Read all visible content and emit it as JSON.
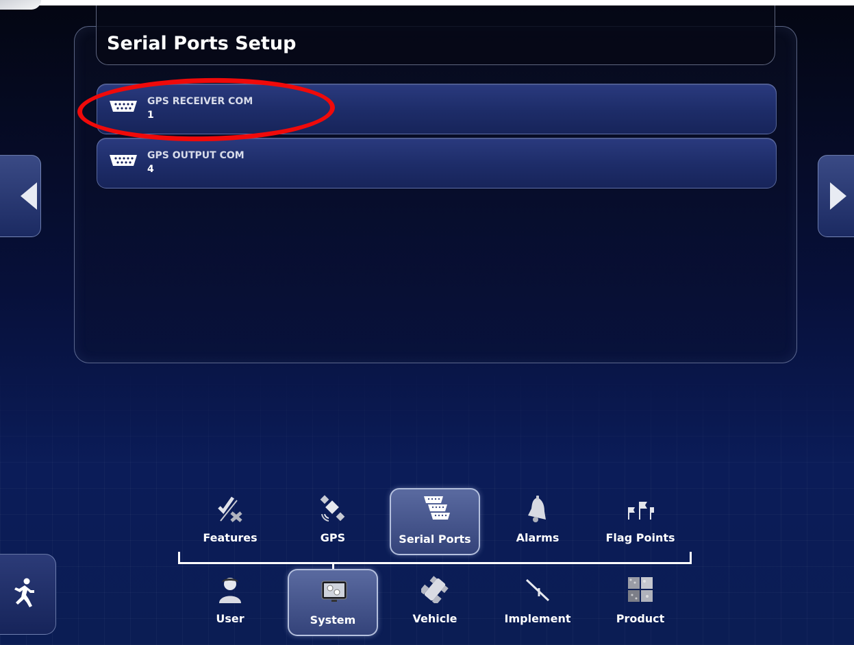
{
  "page": {
    "title": "Serial Ports Setup"
  },
  "ports": [
    {
      "label": "GPS RECEIVER COM",
      "value": "1",
      "icon": "serial-port-icon"
    },
    {
      "label": "GPS OUTPUT COM",
      "value": "4",
      "icon": "serial-port-icon"
    }
  ],
  "nav": {
    "left_icon": "left-arrow-icon",
    "right_icon": "right-arrow-icon",
    "exit_icon": "running-man-icon"
  },
  "sub_tabs": [
    {
      "label": "Features",
      "icon": "check-x-icon",
      "selected": false
    },
    {
      "label": "GPS",
      "icon": "satellite-icon",
      "selected": false
    },
    {
      "label": "Serial Ports",
      "icon": "serial-ports-icon",
      "selected": true
    },
    {
      "label": "Alarms",
      "icon": "bell-icon",
      "selected": false
    },
    {
      "label": "Flag Points",
      "icon": "flags-icon",
      "selected": false
    }
  ],
  "main_tabs": [
    {
      "label": "User",
      "icon": "user-icon",
      "selected": false
    },
    {
      "label": "System",
      "icon": "system-icon",
      "selected": true
    },
    {
      "label": "Vehicle",
      "icon": "vehicle-icon",
      "selected": false
    },
    {
      "label": "Implement",
      "icon": "implement-icon",
      "selected": false
    },
    {
      "label": "Product",
      "icon": "product-icon",
      "selected": false
    }
  ],
  "colors": {
    "annotation": "#f00a0a",
    "background": "#07103a",
    "accent": "#34437a"
  }
}
